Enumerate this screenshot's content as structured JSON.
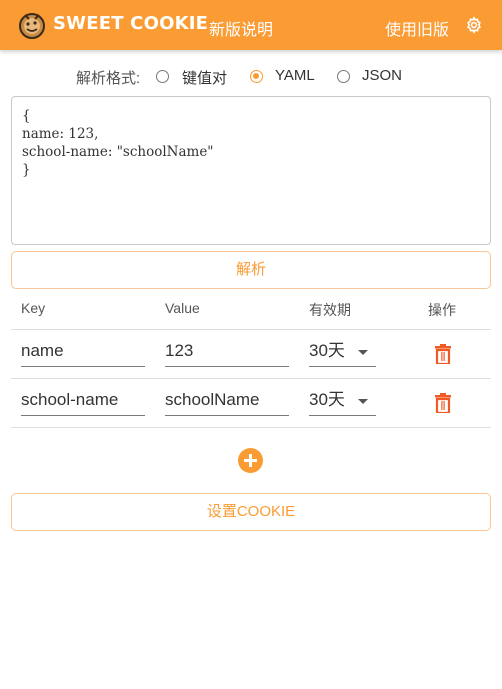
{
  "header": {
    "brand": "SWEET COOKIE",
    "release_notes": "新版说明",
    "old_version": "使用旧版",
    "settings_icon": "gear-icon",
    "logo_icon": "cookie-logo-icon",
    "bg_color": "#fa9b33"
  },
  "format": {
    "label": "解析格式:",
    "options": [
      "键值对",
      "YAML",
      "JSON"
    ],
    "selected": "YAML"
  },
  "editor": {
    "content": "{\nname: 123,\nschool-name: \"schoolName\"\n}"
  },
  "parse_button": "解析",
  "table": {
    "headers": [
      "Key",
      "Value",
      "有效期",
      "操作"
    ],
    "rows": [
      {
        "key": "name",
        "value": "123",
        "expiry": "30天",
        "action_icon": "trash-icon"
      },
      {
        "key": "school-name",
        "value": "schoolName",
        "expiry": "30天",
        "action_icon": "trash-icon"
      }
    ]
  },
  "add_icon": "plus-circle-icon",
  "set_cookie_button": "设置COOKIE",
  "accent_color": "#fa9b33",
  "delete_color": "#f05a24"
}
